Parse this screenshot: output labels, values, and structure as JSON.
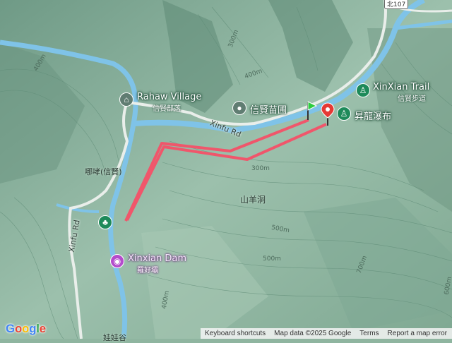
{
  "map": {
    "highway_shield": "北107",
    "places": {
      "rahaw_village": {
        "name": "Rahaw Village",
        "subname": "信賢部落",
        "icon": "tribe-icon"
      },
      "xinxian_nursery": {
        "name": "信賢苗圃",
        "icon": "place-pin-icon"
      },
      "xinxian_trail": {
        "name": "XinXian Trail",
        "subname": "信賢步道",
        "icon": "hiking-icon"
      },
      "shenglong_falls": {
        "name": "昇龍瀑布",
        "icon": "hiking-icon"
      },
      "nazhe": {
        "name": "哪哮(信賢)"
      },
      "shanyang_cave": {
        "name": "山羊洞"
      },
      "xinxian_dam": {
        "name": "Xinxian Dam",
        "subname": "羅好壩",
        "icon": "camera-icon"
      },
      "park": {
        "icon": "tree-icon"
      },
      "bottom_partial": {
        "name": "娃娃谷"
      }
    },
    "roads": {
      "xinfu_rd_east": "Xinfu Rd",
      "xinfu_rd_west": "Xinfu Rd"
    },
    "elevation_labels": [
      "400m",
      "400m",
      "300m",
      "500m",
      "500m",
      "700m",
      "600m",
      "400m",
      "300m"
    ],
    "track": {
      "color": "#f0566b",
      "start_icon": "start-flag-icon",
      "end_icon": "end-pin-icon"
    },
    "colors": {
      "water": "#7fc3e8",
      "track": "#f0566b",
      "start_flag": "#2ecc40",
      "end_pin": "#e53935",
      "poi_green": "#1e8a5a",
      "poi_gray": "#607d72",
      "poi_purple": "#b44ccc"
    }
  },
  "attribution": {
    "logo": "Google",
    "keyboard_shortcuts": "Keyboard shortcuts",
    "map_data": "Map data ©2025 Google",
    "terms": "Terms",
    "report": "Report a map error"
  }
}
